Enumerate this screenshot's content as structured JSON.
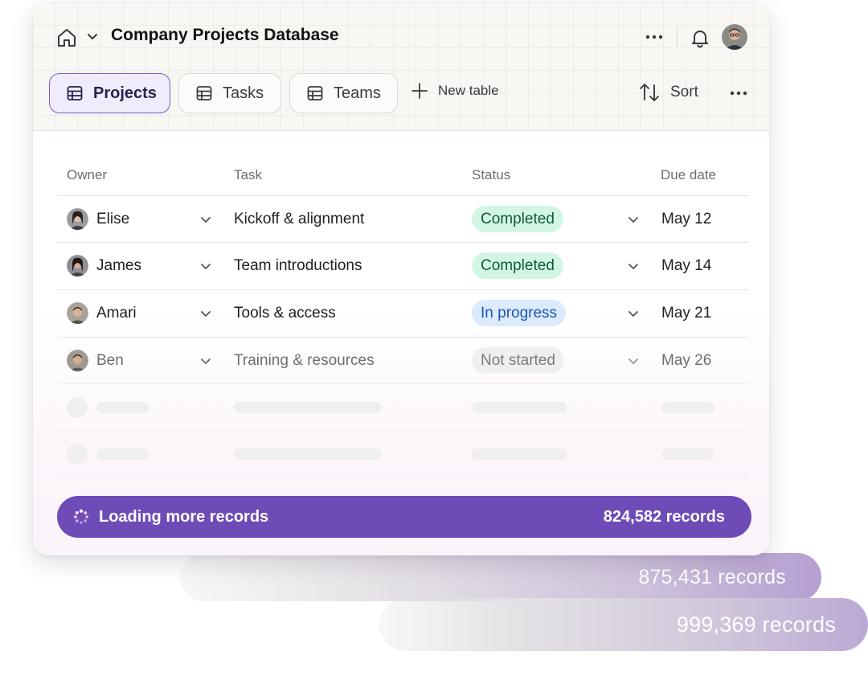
{
  "header": {
    "title": "Company Projects Database",
    "avatar_icon": "user-avatar",
    "icons": [
      "home-icon",
      "chevron-down-icon",
      "more-icon",
      "bell-icon"
    ]
  },
  "toolbar": {
    "tabs": [
      {
        "label": "Projects",
        "active": true,
        "icon": "table-icon"
      },
      {
        "label": "Tasks",
        "active": false,
        "icon": "table-icon"
      },
      {
        "label": "Teams",
        "active": false,
        "icon": "table-icon"
      }
    ],
    "new_table_label": "New table",
    "sort_label": "Sort"
  },
  "table": {
    "columns": [
      "Owner",
      "Task",
      "Status",
      "Due date"
    ],
    "rows": [
      {
        "owner": "Elise",
        "task": "Kickoff & alignment",
        "status": "Completed",
        "status_kind": "done",
        "due": "May 12"
      },
      {
        "owner": "James",
        "task": "Team introductions",
        "status": "Completed",
        "status_kind": "done",
        "due": "May 14"
      },
      {
        "owner": "Amari",
        "task": "Tools & access",
        "status": "In progress",
        "status_kind": "prog",
        "due": "May 21"
      },
      {
        "owner": "Ben",
        "task": "Training & resources",
        "status": "Not started",
        "status_kind": "not",
        "due": "May 26"
      }
    ]
  },
  "loading": {
    "label": "Loading more records",
    "count": "824,582 records"
  },
  "background_counts": [
    "875,431 records",
    "999,369 records"
  ],
  "colors": {
    "accent": "#6f4bb8",
    "completed_bg": "#d3f5e6",
    "in_progress_bg": "#dbeafc",
    "not_started_bg": "#efefef"
  }
}
